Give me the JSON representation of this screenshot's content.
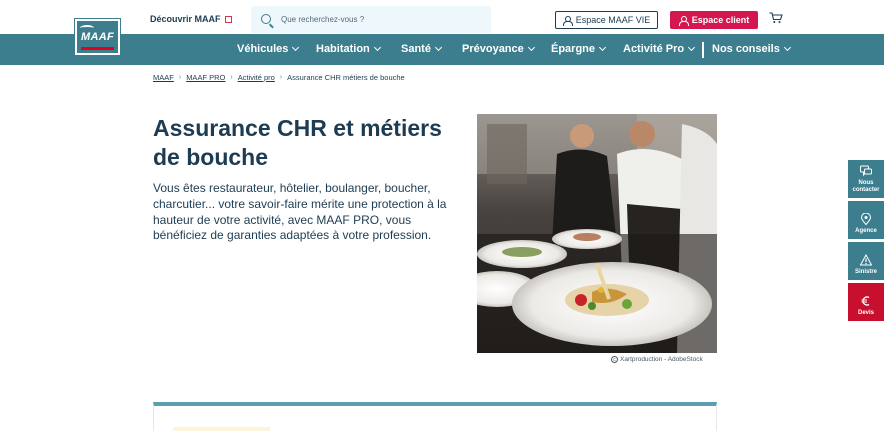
{
  "header": {
    "logo_text": "MAAF",
    "discover_label": "Découvrir MAAF",
    "search_placeholder": "Que recherchez-vous ?",
    "espace_vie_label": "Espace MAAF VIE",
    "espace_client_label": "Espace client"
  },
  "nav": {
    "items": [
      {
        "label": "Véhicules"
      },
      {
        "label": "Habitation"
      },
      {
        "label": "Santé"
      },
      {
        "label": "Prévoyance"
      },
      {
        "label": "Épargne"
      },
      {
        "label": "Activité Pro"
      },
      {
        "label": "Nos conseils"
      }
    ]
  },
  "breadcrumb": {
    "items": [
      "MAAF",
      "MAAF PRO",
      "Activité pro"
    ],
    "current": "Assurance CHR métiers de bouche",
    "separator": "›"
  },
  "main": {
    "title": "Assurance CHR et métiers de bouche",
    "intro": "Vous êtes restaurateur, hôtelier, boulanger, boucher, charcutier... votre savoir-faire mérite une protection à la hauteur de votre activité, avec MAAF PRO, vous bénéficiez de garanties adaptées à votre profession.",
    "image_credit": "Xartproduction - AdobeStock",
    "copyright_symbol": "c"
  },
  "side_widgets": [
    {
      "label": "Nous contacter",
      "icon": "chat-icon"
    },
    {
      "label": "Agence",
      "icon": "map-pin-icon"
    },
    {
      "label": "Sinistre",
      "icon": "warning-icon"
    },
    {
      "label": "Devis",
      "icon": "euro-icon"
    }
  ],
  "colors": {
    "brand_teal": "#3d7e8e",
    "brand_red": "#d5174f",
    "text_navy": "#1d3c52",
    "devis_red": "#c8102e"
  }
}
